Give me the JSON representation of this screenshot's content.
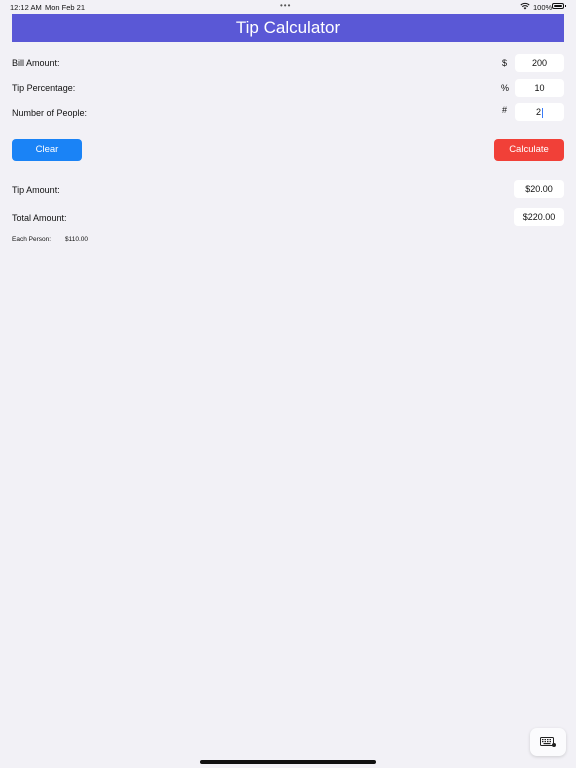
{
  "status_bar": {
    "time": "12:12 AM",
    "date": "Mon Feb 21",
    "battery_percent": "100%"
  },
  "title": "Tip Calculator",
  "inputs": {
    "bill": {
      "label": "Bill Amount:",
      "symbol": "$",
      "value": "200"
    },
    "tip_percent": {
      "label": "Tip Percentage:",
      "symbol": "%",
      "value": "10"
    },
    "people": {
      "label": "Number of People:",
      "symbol": "#",
      "value": "2"
    }
  },
  "buttons": {
    "clear": "Clear",
    "calculate": "Calculate"
  },
  "results": {
    "tip": {
      "label": "Tip Amount:",
      "value": "$20.00"
    },
    "total": {
      "label": "Total Amount:",
      "value": "$220.00"
    },
    "each": {
      "label": "Each Person:",
      "value": "$110.00"
    }
  },
  "colors": {
    "title_bar": "#5a58d6",
    "clear_button": "#1a83f6",
    "calculate_button": "#f14038",
    "background": "#f2f1f6"
  },
  "icons": {
    "keyboard": "keyboard-icon",
    "wifi": "wifi-icon",
    "battery": "battery-icon"
  }
}
